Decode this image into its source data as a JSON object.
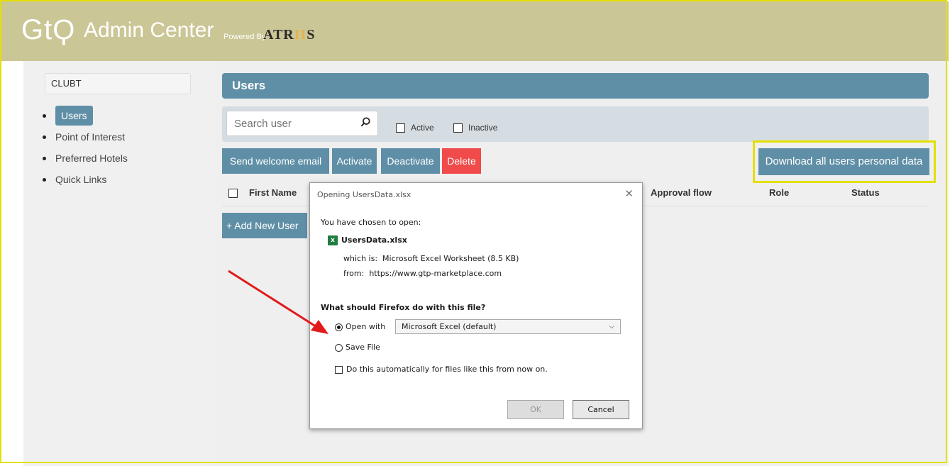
{
  "header": {
    "logo": "GtϘ",
    "title": "Admin Center",
    "powered_by": "Powered By",
    "brand_a": "ATR",
    "brand_b": "II",
    "brand_c": "S"
  },
  "sidebar": {
    "company": "CLUBT",
    "items": [
      {
        "label": "Users"
      },
      {
        "label": "Point of Interest"
      },
      {
        "label": "Preferred Hotels"
      },
      {
        "label": "Quick Links"
      }
    ]
  },
  "main": {
    "title": "Users",
    "search_placeholder": "Search user",
    "filters": {
      "active": "Active",
      "inactive": "Inactive"
    },
    "actions": {
      "send_welcome": "Send welcome email",
      "activate": "Activate",
      "deactivate": "Deactivate",
      "delete": "Delete",
      "download": "Download all users personal data"
    },
    "columns": [
      "First Name",
      "Approval flow",
      "Role",
      "Status"
    ],
    "add_user": "+ Add New User"
  },
  "dialog": {
    "title": "Opening UsersData.xlsx",
    "chosen": "You have chosen to open:",
    "file_name": "UsersData.xlsx",
    "which_is_label": "which is:",
    "which_is_value": "Microsoft Excel Worksheet (8.5 KB)",
    "from_label": "from:",
    "from_value": "https://www.gtp-marketplace.com",
    "question": "What should Firefox do with this file?",
    "open_with": "Open with",
    "open_with_app": "Microsoft Excel (default)",
    "save_file": "Save File",
    "auto": "Do this automatically for files like this from now on.",
    "ok": "OK",
    "cancel": "Cancel"
  },
  "colors": {
    "header_bg": "#cbc696",
    "accent": "#5f8fa6",
    "delete": "#f04a4a",
    "highlight": "#e3e000",
    "arrow": "#e11b1b"
  }
}
